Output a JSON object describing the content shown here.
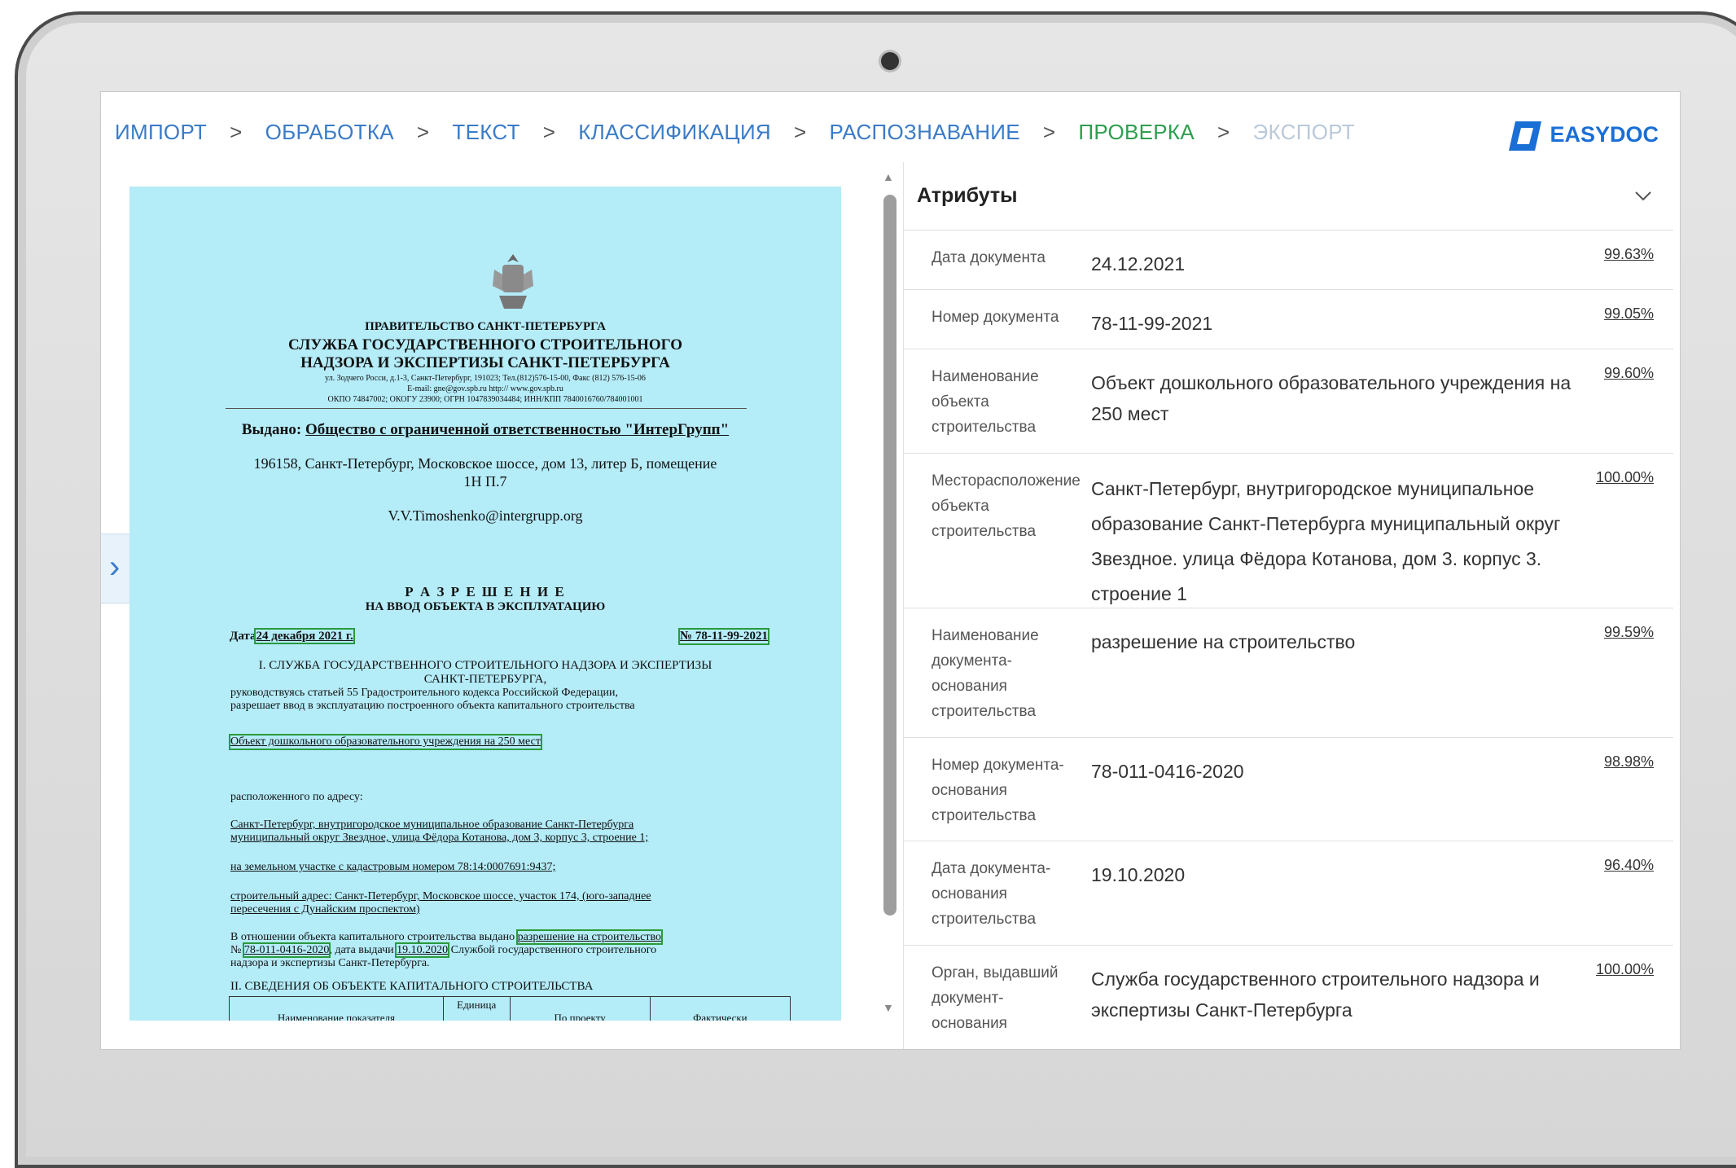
{
  "steps": [
    {
      "label": "ИМПОРТ",
      "state": "done"
    },
    {
      "label": "ОБРАБОТКА",
      "state": "done"
    },
    {
      "label": "ТЕКСТ",
      "state": "done"
    },
    {
      "label": "КЛАССИФИКАЦИЯ",
      "state": "done"
    },
    {
      "label": "РАСПОЗНАВАНИЕ",
      "state": "done"
    },
    {
      "label": "ПРОВЕРКА",
      "state": "active"
    },
    {
      "label": "ЭКСПОРТ",
      "state": "disabled"
    }
  ],
  "step_separator": ">",
  "logo": {
    "text": "EASYDOC",
    "color": "#1a6fd6"
  },
  "document": {
    "org1": "ПРАВИТЕЛЬСТВО САНКТ-ПЕТЕРБУРГА",
    "org2": "СЛУЖБА ГОСУДАРСТВЕННОГО СТРОИТЕЛЬНОГО",
    "org3": "НАДЗОРА И ЭКСПЕРТИЗЫ САНКТ-ПЕТЕРБУРГА",
    "addr1": "ул. Зодчего Росси, д.1-3, Санкт-Петербург, 191023; Тел.(812)576-15-00, Факс (812) 576-15-06",
    "addr2": "E-mail: gne@gov.spb.ru    http:// www.gov.spb.ru",
    "addr3": "ОКПО 74847002; ОКОГУ 23900; ОГРН 1047839034484; ИНН/КПП 7840016760/784001001",
    "issued_label": "Выдано:",
    "issued_to": "Общество с ограниченной ответственностью \"ИнтерГрупп\"",
    "address_line1": "196158, Санкт-Петербург, Московское шоссе, дом 13, литер Б, помещение",
    "address_line2": "1Н П.7",
    "email": "V.V.Timoshenko@intergrupp.org",
    "title1": "Р А З Р Е Ш Е Н И Е",
    "title2": "НА ВВОД ОБЪЕКТА В ЭКСПЛУАТАЦИЮ",
    "date_label": "Дата",
    "date_value": "24 декабря 2021 г.",
    "number_value": "№ 78-11-99-2021",
    "s1a": "I. СЛУЖБА ГОСУДАРСТВЕННОГО СТРОИТЕЛЬНОГО НАДЗОРА И ЭКСПЕРТИЗЫ",
    "s1b": "САНКТ-ПЕТЕРБУРГА,",
    "s1c": "руководствуясь статьей 55 Градостроительного кодекса Российской Федерации,",
    "s1d": "разрешает ввод в эксплуатацию построенного объекта капитального строительства",
    "object": "Объект дошкольного образовательного учреждения на 250 мест",
    "located": "расположенного по адресу:",
    "loc1": "Санкт-Петербург, внутригородское муниципальное образование Санкт-Петербурга",
    "loc2": "муниципальный округ Звездное, улица Фёдора Котанова, дом 3, корпус 3, строение 1;",
    "cad": "на земельном участке с кадастровым номером 78:14:0007691:9437;",
    "build1": "строительный адрес: Санкт-Петербург, Московское шоссе, участок 174, (юго-западнее",
    "build2": "пересечения с Дунайским проспектом)",
    "rel1": "В отношении объекта капитального строительства выдано",
    "rel1b": "разрешение на строительство",
    "rel2a": "№",
    "rel2num": "78-011-0416-2020",
    "rel2b": ", дата выдачи",
    "rel2date": "19.10.2020",
    "rel2c": "Службой государственного строительного",
    "rel3": "надзора и экспертизы Санкт-Петербурга.",
    "s2": "II. СВЕДЕНИЯ ОБ ОБЪЕКТЕ КАПИТАЛЬНОГО СТРОИТЕЛЬСТВА",
    "th1": "Наименование показателя",
    "th2": "Единица",
    "th3": "По проекту",
    "th4": "Фактически"
  },
  "panel": {
    "title": "Атрибуты",
    "rows": [
      {
        "label": "Дата документа",
        "value": "24.12.2021",
        "pct": "99.63%"
      },
      {
        "label": "Номер документа",
        "value": "78-11-99-2021",
        "pct": "99.05%"
      },
      {
        "label": "Наименование объекта строительства",
        "value": "Объект дошкольного образовательного учреждения на 250 мест",
        "pct": "99.60%"
      },
      {
        "label": "Месторасположение объекта строительства",
        "value": "Санкт-Петербург, внутригородское муниципальное образование Санкт-Петербурга муниципальный округ Звездное. улица Фёдора Котанова, дом 3. корпус 3. строение 1",
        "pct": "100.00%"
      },
      {
        "label": "Наименование документа-основания строительства",
        "value": "разрешение на строительство",
        "pct": "99.59%"
      },
      {
        "label": "Номер документа-основания строительства",
        "value": "78-011-0416-2020",
        "pct": "98.98%"
      },
      {
        "label": "Дата документа-основания строительства",
        "value": "19.10.2020",
        "pct": "96.40%"
      },
      {
        "label": "Орган, выдавший документ-основания",
        "value": "Служба государственного строительного надзора и экспертизы Санкт-Петербурга",
        "pct": "100.00%"
      }
    ]
  }
}
